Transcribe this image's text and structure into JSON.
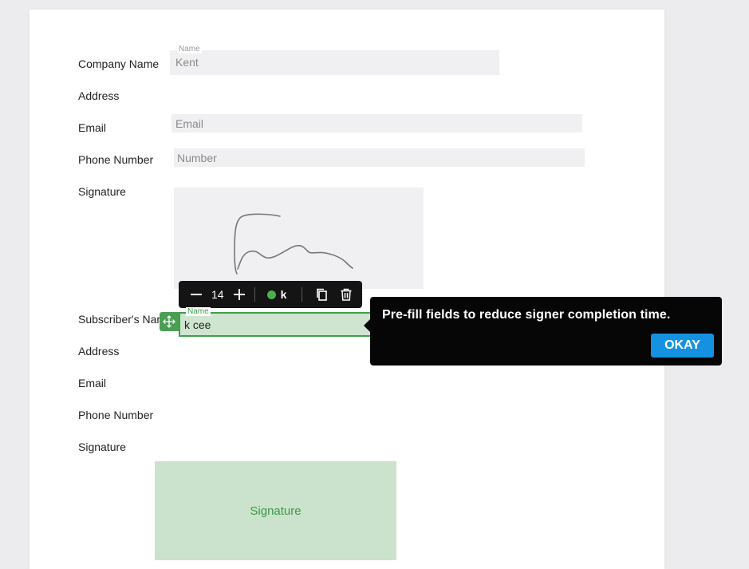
{
  "form": {
    "labels": {
      "company_name": "Company Name",
      "address": "Address",
      "email": "Email",
      "phone_number": "Phone Number",
      "signature": "Signature",
      "subscribers_name": "Subscriber's Name",
      "address2": "Address",
      "email2": "Email",
      "phone_number2": "Phone Number",
      "signature2": "Signature"
    },
    "company_name_field": {
      "tag": "Name",
      "value": "Kent"
    },
    "email_field": {
      "placeholder": "Email"
    },
    "phone_field": {
      "placeholder": "Number"
    },
    "subscriber_field": {
      "tag": "Name",
      "value": "k cee"
    },
    "signature_placeholder": "Signature"
  },
  "toolbar": {
    "font_size": "14",
    "signer_initial": "k",
    "signer_color": "#4caf50"
  },
  "tooltip": {
    "message": "Pre-fill fields to reduce signer completion time.",
    "okay_label": "OKAY"
  }
}
